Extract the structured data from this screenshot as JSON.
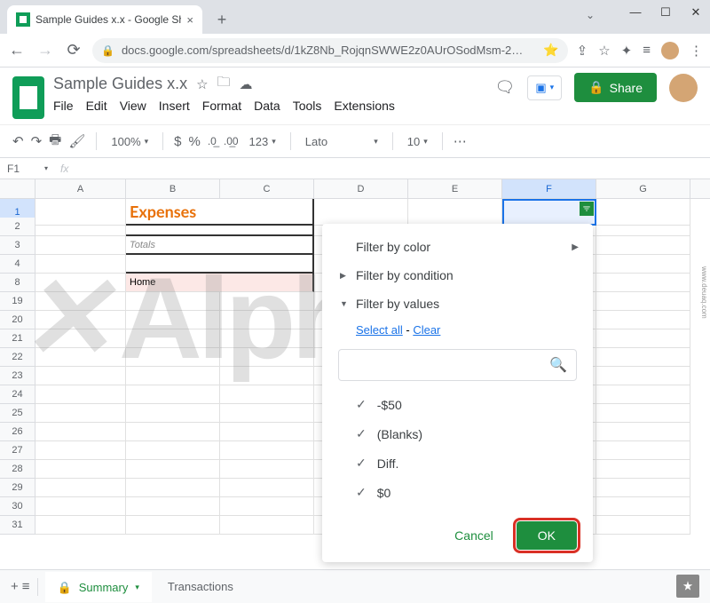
{
  "browser": {
    "tab_title": "Sample Guides x.x - Google She",
    "url": "docs.google.com/spreadsheets/d/1kZ8Nb_RojqnSWWE2z0AUrOSodMsm-2…"
  },
  "doc": {
    "title": "Sample Guides x.x",
    "menus": [
      "File",
      "Edit",
      "View",
      "Insert",
      "Format",
      "Data",
      "Tools",
      "Extensions"
    ],
    "share": "Share"
  },
  "toolbar": {
    "zoom": "100%",
    "currency": "$",
    "percent": "%",
    "dec0": ".0",
    "dec00": ".00",
    "fmt": "123",
    "font": "Lato",
    "size": "10",
    "more": "…"
  },
  "fx": {
    "cell": "F1",
    "symbol": "fx"
  },
  "columns": [
    "A",
    "B",
    "C",
    "D",
    "E",
    "F",
    "G"
  ],
  "rows_visible": [
    "1",
    "2",
    "3",
    "4",
    "8",
    "19",
    "20",
    "21",
    "22",
    "23",
    "24",
    "25",
    "26",
    "27",
    "28",
    "29",
    "30",
    "31"
  ],
  "content": {
    "b1": "Expenses",
    "b3": "Totals",
    "b8": "Home"
  },
  "filter": {
    "by_color": "Filter by color",
    "by_condition": "Filter by condition",
    "by_values": "Filter by values",
    "select_all": "Select all",
    "clear": "Clear",
    "values": [
      "-$50",
      "(Blanks)",
      "Diff.",
      "$0"
    ],
    "cancel": "Cancel",
    "ok": "OK"
  },
  "tabs": {
    "summary": "Summary",
    "transactions": "Transactions"
  },
  "watermark": "Alphr"
}
